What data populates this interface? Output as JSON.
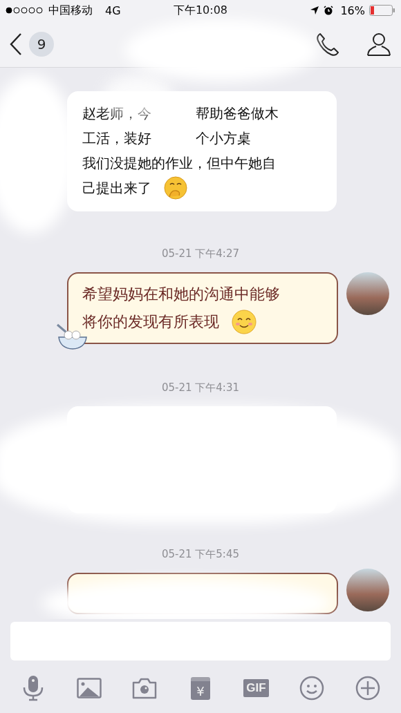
{
  "status_bar": {
    "carrier": "中国移动",
    "network": "4G",
    "time": "下午10:08",
    "battery": "16%"
  },
  "nav": {
    "unread_count": "9"
  },
  "messages": [
    {
      "kind": "incoming",
      "lines": [
        [
          "赵老师，今",
          "帮助爸爸做木"
        ],
        [
          "工活，装好",
          "个小方桌"
        ],
        [
          "我们没提她的作业，但中午她自"
        ],
        [
          "己提出来了"
        ]
      ],
      "emoji": true
    },
    {
      "kind": "outgoing",
      "timestamp": "05-21 下午4:27",
      "lines": [
        [
          "希望妈妈在和她的沟通中能够"
        ],
        [
          "将你的发现有所表现"
        ]
      ],
      "emoji": true
    },
    {
      "kind": "incoming",
      "timestamp": "05-21 下午4:31"
    },
    {
      "kind": "outgoing",
      "timestamp": "05-21 下午5:45"
    }
  ],
  "toolbar": [
    {
      "kind": "mic"
    },
    {
      "kind": "image"
    },
    {
      "kind": "camera"
    },
    {
      "kind": "red-packet",
      "glyph": "¥"
    },
    {
      "kind": "gif",
      "glyph": "GIF"
    },
    {
      "kind": "emoji"
    },
    {
      "kind": "plus"
    }
  ]
}
